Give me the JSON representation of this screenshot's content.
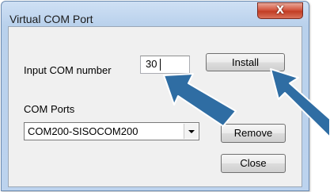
{
  "window": {
    "title": "Virtual COM Port",
    "close_glyph": "X"
  },
  "form": {
    "input_label": "Input COM number",
    "com_number_value": "30",
    "install_label": "Install",
    "ports_label": "COM Ports",
    "ports_selected": "COM200-SISOCOM200",
    "remove_label": "Remove",
    "close_label": "Close"
  },
  "annotations": {
    "arrow_color": "#2f6da3"
  }
}
